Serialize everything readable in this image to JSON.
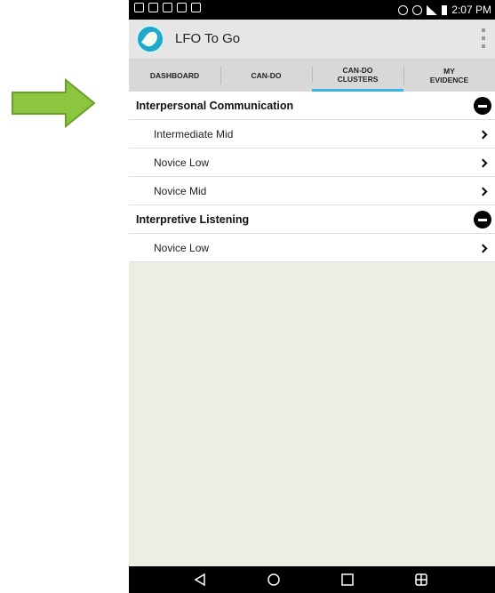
{
  "status_bar": {
    "time": "2:07 PM"
  },
  "app": {
    "title": "LFO To Go"
  },
  "tabs": [
    {
      "label": "DASHBOARD",
      "active": false
    },
    {
      "label": "CAN-DO",
      "active": false
    },
    {
      "label": "CAN-DO CLUSTERS",
      "active": true
    },
    {
      "label": "MY EVIDENCE",
      "active": false
    }
  ],
  "sections": [
    {
      "title": "Interpersonal Communication",
      "items": [
        "Intermediate Mid",
        "Novice Low",
        "Novice Mid"
      ]
    },
    {
      "title": "Interpretive Listening",
      "items": [
        "Novice Low"
      ]
    }
  ],
  "colors": {
    "annotation_arrow": "#8cc63f",
    "tab_indicator": "#33b5e5",
    "logo": "#1fa8c9"
  },
  "icons": [
    "arrow-right-icon",
    "app-logo-icon",
    "overflow-menu-icon",
    "collapse-icon",
    "chevron-right-icon",
    "back-icon",
    "home-icon",
    "recents-icon",
    "multiwindow-icon"
  ]
}
